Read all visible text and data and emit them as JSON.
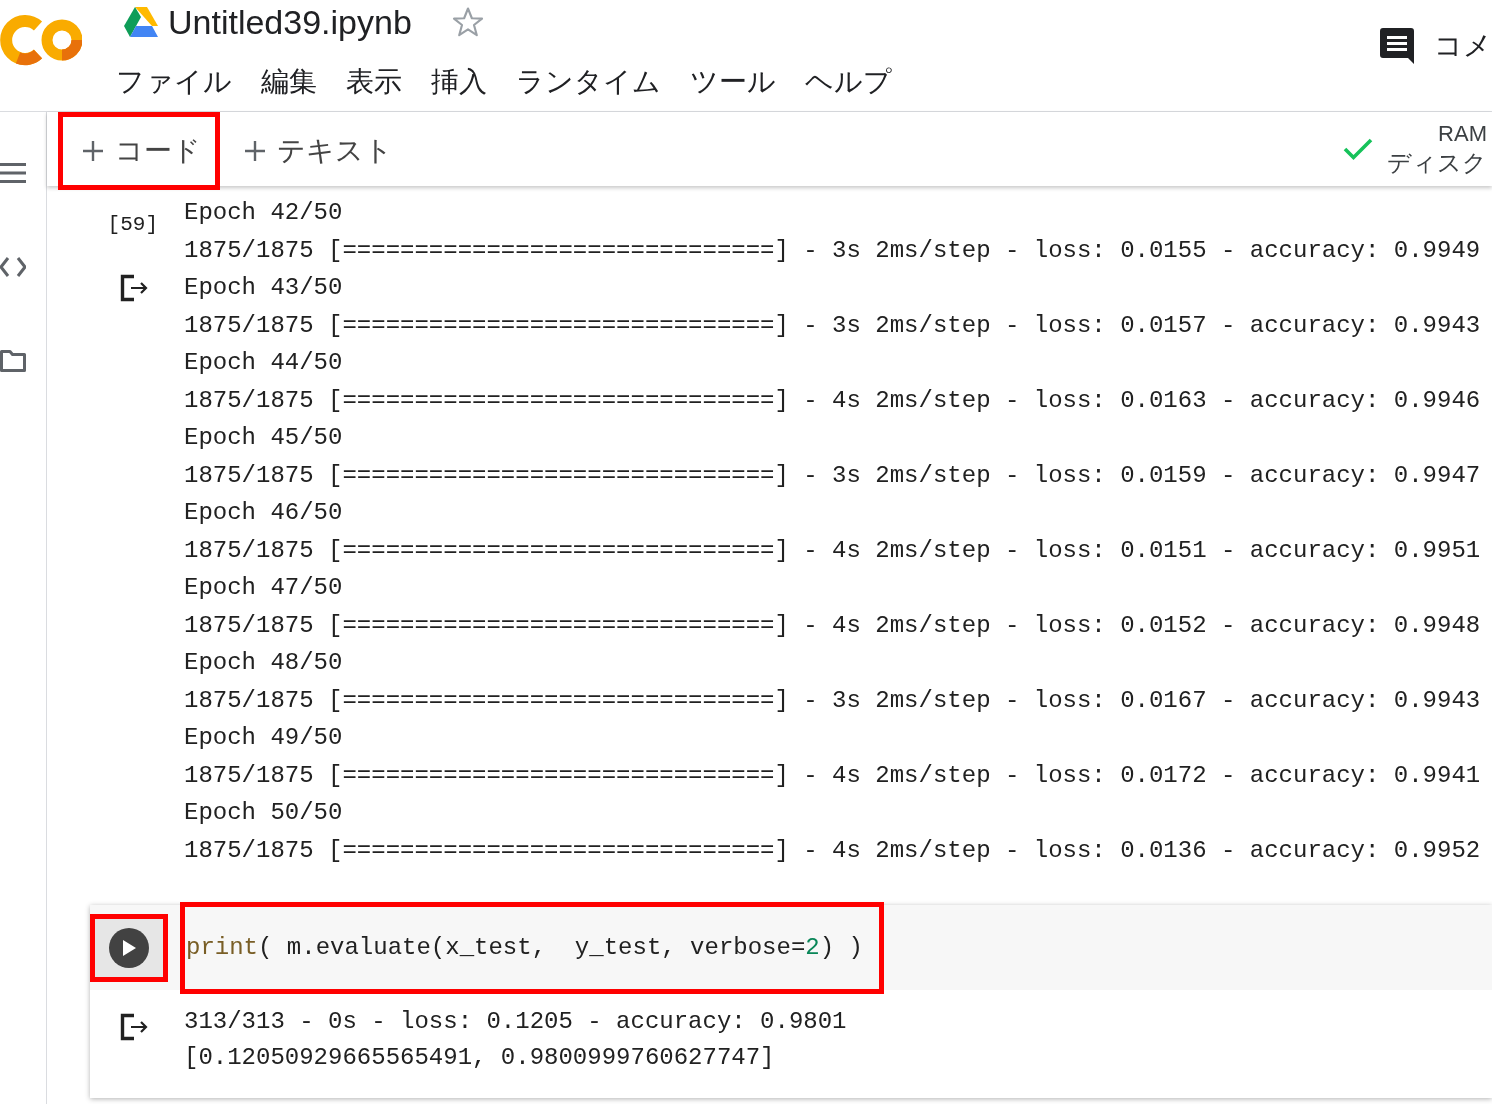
{
  "header": {
    "title": "Untitled39.ipynb",
    "starred": false,
    "menu": [
      "ファイル",
      "編集",
      "表示",
      "挿入",
      "ランタイム",
      "ツール",
      "ヘルプ"
    ],
    "comments_label": "コメ"
  },
  "toolbar": {
    "buttons": [
      {
        "label": "コード",
        "highlighted": true
      },
      {
        "label": "テキスト",
        "highlighted": false
      }
    ],
    "runtime": {
      "connected": true,
      "ram_label": "RAM",
      "disk_label": "ディスク"
    }
  },
  "cells": [
    {
      "kind": "output",
      "execution_count": "[59]",
      "output_lines": [
        "Epoch 42/50",
        "1875/1875 [==============================] - 3s 2ms/step - loss: 0.0155 - accuracy: 0.9949",
        "Epoch 43/50",
        "1875/1875 [==============================] - 3s 2ms/step - loss: 0.0157 - accuracy: 0.9943",
        "Epoch 44/50",
        "1875/1875 [==============================] - 4s 2ms/step - loss: 0.0163 - accuracy: 0.9946",
        "Epoch 45/50",
        "1875/1875 [==============================] - 3s 2ms/step - loss: 0.0159 - accuracy: 0.9947",
        "Epoch 46/50",
        "1875/1875 [==============================] - 4s 2ms/step - loss: 0.0151 - accuracy: 0.9951",
        "Epoch 47/50",
        "1875/1875 [==============================] - 4s 2ms/step - loss: 0.0152 - accuracy: 0.9948",
        "Epoch 48/50",
        "1875/1875 [==============================] - 3s 2ms/step - loss: 0.0167 - accuracy: 0.9943",
        "Epoch 49/50",
        "1875/1875 [==============================] - 4s 2ms/step - loss: 0.0172 - accuracy: 0.9941",
        "Epoch 50/50",
        "1875/1875 [==============================] - 4s 2ms/step - loss: 0.0136 - accuracy: 0.9952"
      ]
    },
    {
      "kind": "code",
      "run_highlighted": true,
      "code_highlighted": true,
      "code_tokens": [
        {
          "kind": "builtin",
          "text": "print"
        },
        {
          "kind": "plain",
          "text": "( m.evaluate(x_test,  y_test, verbose="
        },
        {
          "kind": "number",
          "text": "2"
        },
        {
          "kind": "plain",
          "text": ") )"
        }
      ],
      "output_lines": [
        "313/313 - 0s - loss: 0.1205 - accuracy: 0.9801",
        "[0.12050929665565491, 0.9800999760627747]"
      ]
    }
  ]
}
